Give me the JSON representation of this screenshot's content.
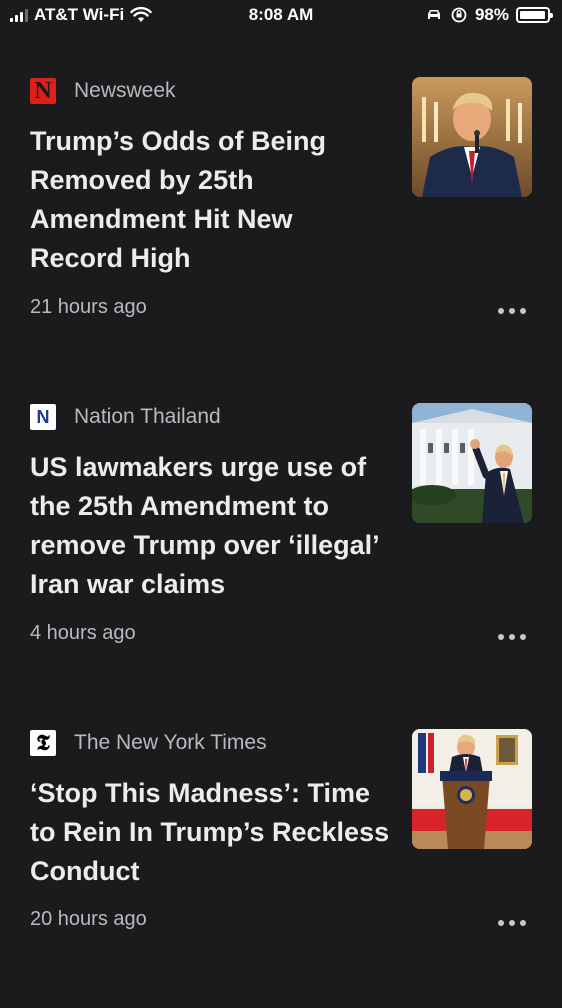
{
  "status_bar": {
    "carrier": "AT&T Wi-Fi",
    "time": "8:08 AM",
    "battery": "98%",
    "battery_level": 0.98,
    "icons": [
      "signal-icon",
      "wifi-icon",
      "car-icon",
      "orientation-lock-icon",
      "battery-icon"
    ]
  },
  "articles": [
    {
      "source": "Newsweek",
      "logo_letter": "N",
      "headline": "Trump’s Odds of Being Removed by 25th Amendment Hit New Record High",
      "time": "21 hours ago",
      "thumbnail": "man-at-podium-chandelier-photo"
    },
    {
      "source": "Nation Thailand",
      "logo_letter": "N",
      "headline": "US lawmakers urge use of the 25th Amendment to remove Trump over ‘illegal’ Iran war claims",
      "time": "4 hours ago",
      "thumbnail": "man-waving-white-house-photo"
    },
    {
      "source": "The New York Times",
      "logo_letter": "𝕿",
      "headline": "‘Stop This Madness’: Time to Rein In Trump’s Reckless Conduct",
      "time": "20 hours ago",
      "thumbnail": "man-at-presidential-lectern-photo"
    }
  ],
  "colors": {
    "background": "#1b1b1d",
    "headline": "#ececee",
    "meta_text": "#b9b9be",
    "newsweek_red": "#e02018"
  }
}
